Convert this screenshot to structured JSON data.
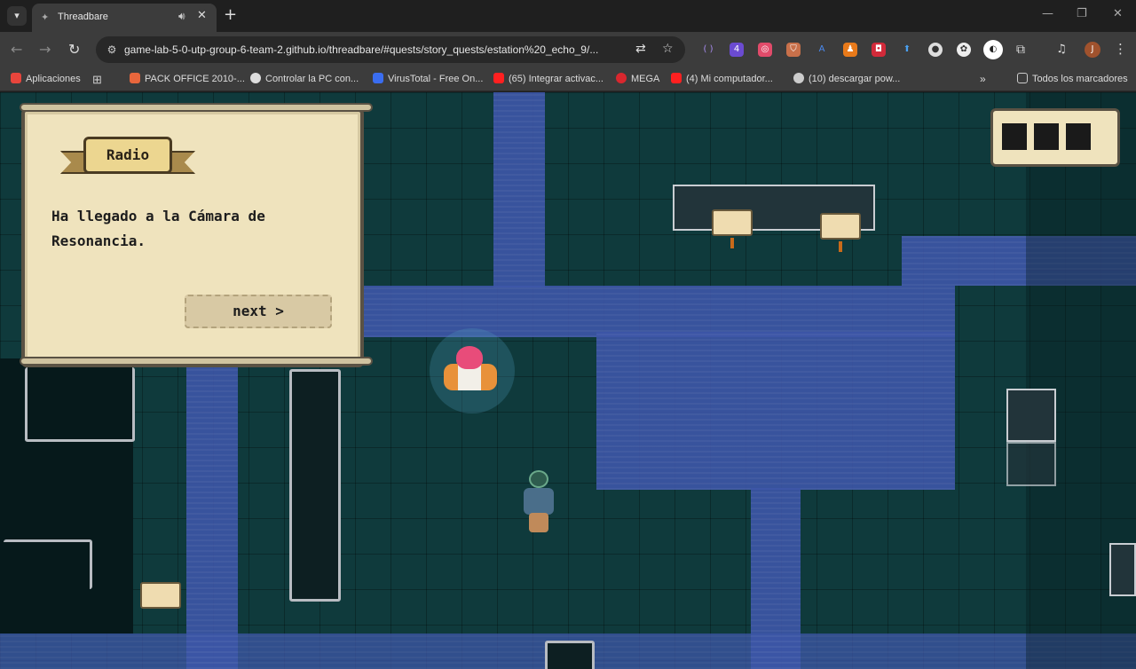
{
  "browser": {
    "tab_title": "Threadbare",
    "url": "game-lab-5-0-utp-group-6-team-2.github.io/threadbare/#quests/story_quests/estation%20_echo_9/...",
    "bookmarks": [
      {
        "label": "Aplicaciones",
        "icon": "apps-grid-icon",
        "color": "#e8453c"
      },
      {
        "label": "PACK OFFICE 2010-...",
        "icon": "office-icon",
        "color": "#e8663c"
      },
      {
        "label": "Controlar la PC con...",
        "icon": "remote-icon",
        "color": "#dddddd"
      },
      {
        "label": "VirusTotal - Free On...",
        "icon": "virustotal-icon",
        "color": "#3a6df0"
      },
      {
        "label": "(65) Integrar activac...",
        "icon": "youtube-icon",
        "color": "#ff2020"
      },
      {
        "label": "MEGA",
        "icon": "mega-icon",
        "color": "#d9272e"
      },
      {
        "label": "(4) Mi computador...",
        "icon": "youtube-icon",
        "color": "#ff2020"
      },
      {
        "label": "(10) descargar pow...",
        "icon": "globe-icon",
        "color": "#cccccc"
      }
    ],
    "all_bookmarks_label": "Todos los marcadores",
    "profile_initial": "J",
    "ext_badge": "4"
  },
  "game": {
    "dialog": {
      "speaker": "Radio",
      "text": "Ha llegado a la Cámara de Resonancia.",
      "next_label": "next >"
    }
  },
  "colors": {
    "floor": "#0f3a3c",
    "walkway": "#3d56a8",
    "parchment": "#efe3bd"
  }
}
